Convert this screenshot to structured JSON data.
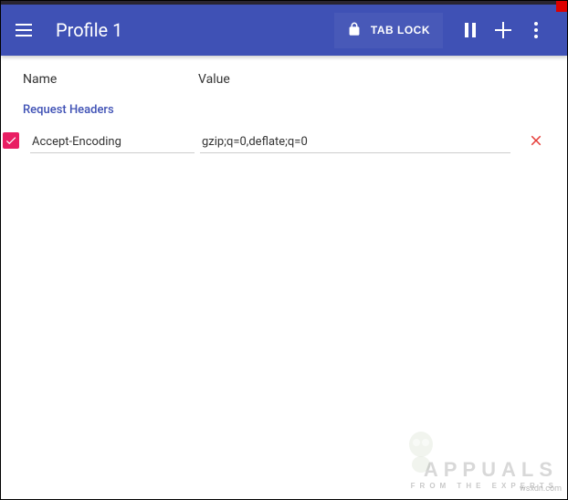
{
  "header": {
    "title": "Profile 1",
    "tab_lock_label": "TAB LOCK"
  },
  "columns": {
    "name": "Name",
    "value": "Value"
  },
  "section": {
    "request_headers_label": "Request Headers"
  },
  "rows": [
    {
      "checked": true,
      "name": "Accept-Encoding",
      "value": "gzip;q=0,deflate;q=0"
    }
  ],
  "watermark": {
    "main": "APPUALS",
    "sub": "FROM THE EXPERTS",
    "domain": "wsxdn.com"
  }
}
